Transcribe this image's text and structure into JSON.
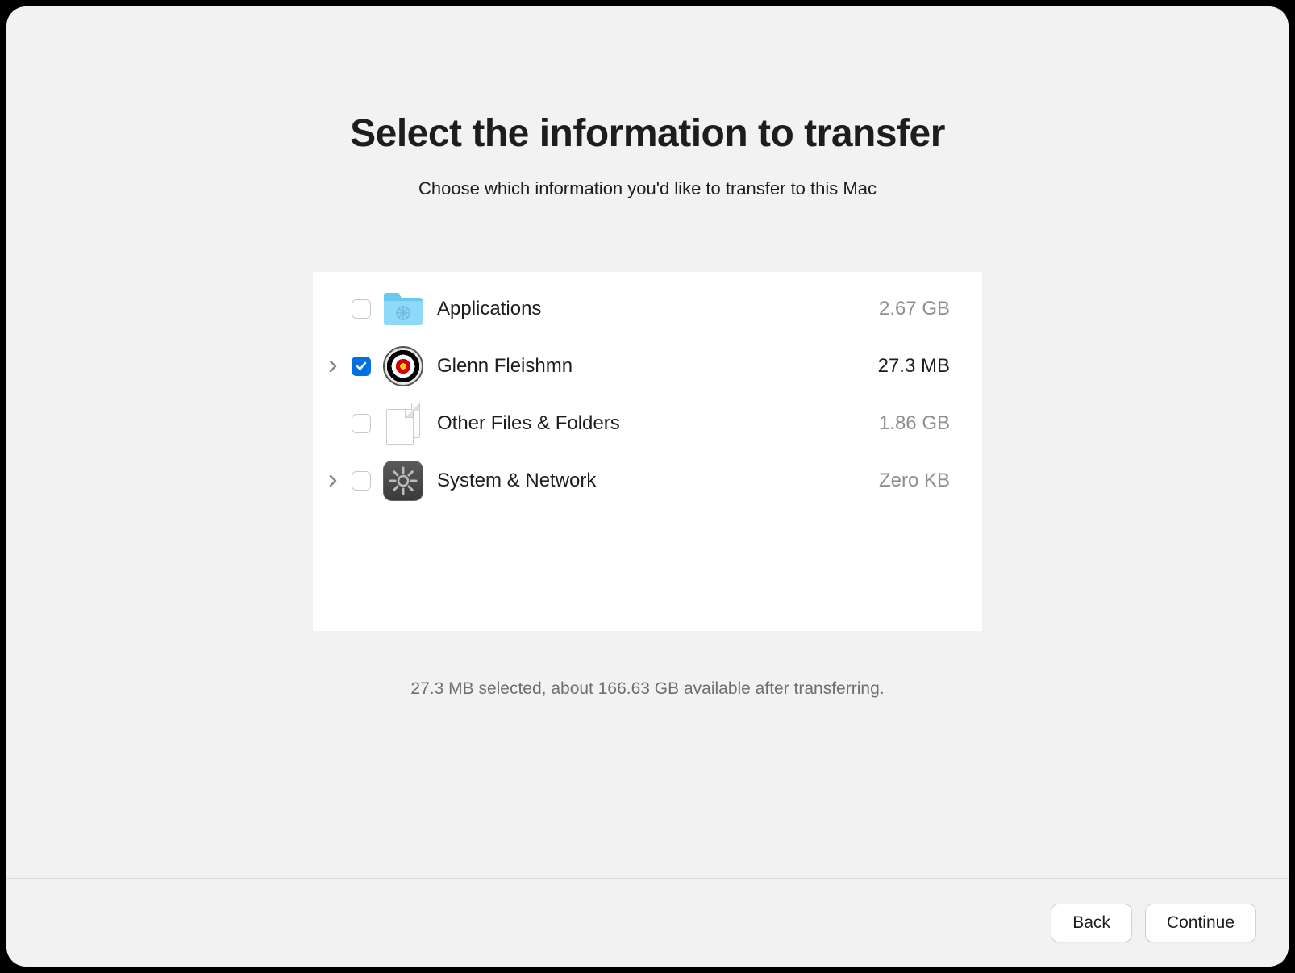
{
  "header": {
    "title": "Select the information to transfer",
    "subtitle": "Choose which information you'd like to transfer to this Mac"
  },
  "items": [
    {
      "label": "Applications",
      "size": "2.67 GB",
      "checked": false,
      "expandable": false,
      "icon": "applications-folder-icon"
    },
    {
      "label": "Glenn Fleishmn",
      "size": "27.3 MB",
      "checked": true,
      "expandable": true,
      "icon": "user-target-icon"
    },
    {
      "label": "Other Files & Folders",
      "size": "1.86 GB",
      "checked": false,
      "expandable": false,
      "icon": "documents-icon"
    },
    {
      "label": "System & Network",
      "size": "Zero KB",
      "checked": false,
      "expandable": true,
      "icon": "system-settings-icon"
    }
  ],
  "status": "27.3 MB selected, about 166.63 GB available after transferring.",
  "buttons": {
    "back": "Back",
    "continue": "Continue"
  }
}
